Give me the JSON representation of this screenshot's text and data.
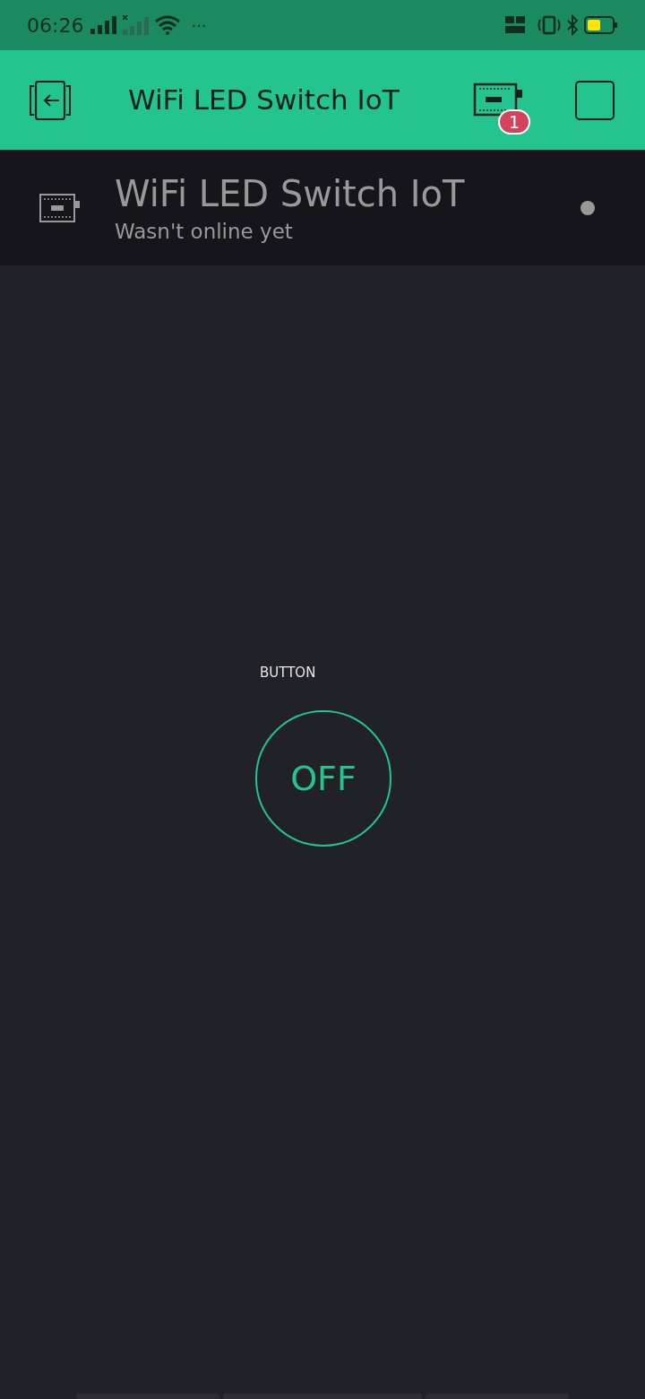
{
  "status_bar": {
    "time": "06:26",
    "more": "···"
  },
  "header": {
    "title": "WiFi LED Switch IoT",
    "device_badge": "1"
  },
  "device": {
    "name": "WiFi LED Switch IoT",
    "status": "Wasn't online yet",
    "online": false
  },
  "widgets": [
    {
      "kind": "button",
      "label": "BUTTON",
      "on": false,
      "text": "OFF"
    }
  ]
}
